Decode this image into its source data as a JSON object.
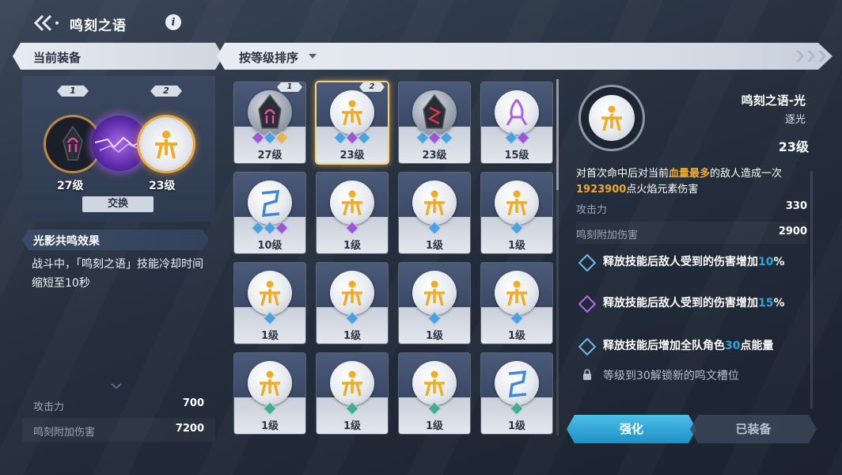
{
  "top": {
    "title": "鸣刻之语",
    "info_glyph": "i"
  },
  "left_header": "当前装备",
  "sort_label": "按等级排序",
  "current": {
    "slot1_badge": "1",
    "slot2_badge": "2",
    "slot1_level": "27级",
    "slot2_level": "23级",
    "swap_label": "交换"
  },
  "resonance": {
    "title": "光影共鸣效果",
    "desc": "战斗中，「鸣刻之语」技能冷却时间缩短至10秒"
  },
  "left_stats": [
    {
      "name": "攻击力",
      "value": "700"
    },
    {
      "name": "鸣刻附加伤害",
      "value": "7200"
    }
  ],
  "cards": [
    {
      "level": "27级",
      "badge": "1",
      "type": "dark-pink",
      "gems": [
        "purple",
        "blue",
        "gold"
      ],
      "selected": false
    },
    {
      "level": "23级",
      "badge": "2",
      "type": "gold",
      "gems": [
        "blue",
        "purple",
        "blue"
      ],
      "selected": true
    },
    {
      "level": "23级",
      "badge": "",
      "type": "dark-red",
      "gems": [
        "blue",
        "purple",
        "blue"
      ],
      "selected": false
    },
    {
      "level": "15级",
      "badge": "",
      "type": "purple",
      "gems": [
        "blue",
        "purple"
      ],
      "selected": false
    },
    {
      "level": "10级",
      "badge": "",
      "type": "blue",
      "gems": [
        "blue",
        "blue",
        "purple"
      ],
      "selected": false
    },
    {
      "level": "1级",
      "badge": "",
      "type": "gold",
      "gems": [
        "purple"
      ],
      "selected": false
    },
    {
      "level": "1级",
      "badge": "",
      "type": "gold",
      "gems": [
        "blue"
      ],
      "selected": false
    },
    {
      "level": "1级",
      "badge": "",
      "type": "gold",
      "gems": [
        "blue"
      ],
      "selected": false
    },
    {
      "level": "1级",
      "badge": "",
      "type": "gold",
      "gems": [
        "blue"
      ],
      "selected": false
    },
    {
      "level": "1级",
      "badge": "",
      "type": "gold",
      "gems": [
        "blue"
      ],
      "selected": false
    },
    {
      "level": "1级",
      "badge": "",
      "type": "gold",
      "gems": [
        "blue"
      ],
      "selected": false
    },
    {
      "level": "1级",
      "badge": "",
      "type": "gold",
      "gems": [
        "blue"
      ],
      "selected": false
    },
    {
      "level": "1级",
      "badge": "",
      "type": "gold",
      "gems": [
        "green"
      ],
      "selected": false
    },
    {
      "level": "1级",
      "badge": "",
      "type": "gold",
      "gems": [
        "green"
      ],
      "selected": false
    },
    {
      "level": "1级",
      "badge": "",
      "type": "gold",
      "gems": [
        "green"
      ],
      "selected": false
    },
    {
      "level": "1级",
      "badge": "",
      "type": "blue",
      "gems": [
        "green"
      ],
      "selected": false
    }
  ],
  "detail": {
    "name": "鸣刻之语-光",
    "sub": "逐光",
    "level": "23级",
    "desc_pre": "对首次命中后对当前",
    "desc_hl1": "血量最多",
    "desc_mid": "的敌人造成一次",
    "desc_hl2": "1923900",
    "desc_post": "点火焰元素伤害",
    "stats": [
      {
        "name": "攻击力",
        "value": "330"
      },
      {
        "name": "鸣刻附加伤害",
        "value": "2900"
      }
    ],
    "effects": [
      {
        "pre": "释放技能后敌人受到的伤害增加",
        "num": "10",
        "post": "%",
        "color": "#6fb9e8"
      },
      {
        "pre": "释放技能后敌人受到的伤害增加",
        "num": "15",
        "post": "%",
        "color": "#b06ae8"
      },
      {
        "pre": "释放技能后增加全队角色",
        "num": "30",
        "post": "点能量",
        "color": "#6fb9e8"
      }
    ],
    "lock_text": "等级到30解锁新的鸣文槽位"
  },
  "buttons": {
    "enhance": "强化",
    "equipped": "已装备"
  },
  "colors": {
    "accent": "#2aa6dc",
    "highlight": "#f2a928",
    "gem_blue": "#4aa3e0",
    "gem_purple": "#9a57d8",
    "gem_gold": "#e6b64a",
    "gem_green": "#3fae8a"
  }
}
